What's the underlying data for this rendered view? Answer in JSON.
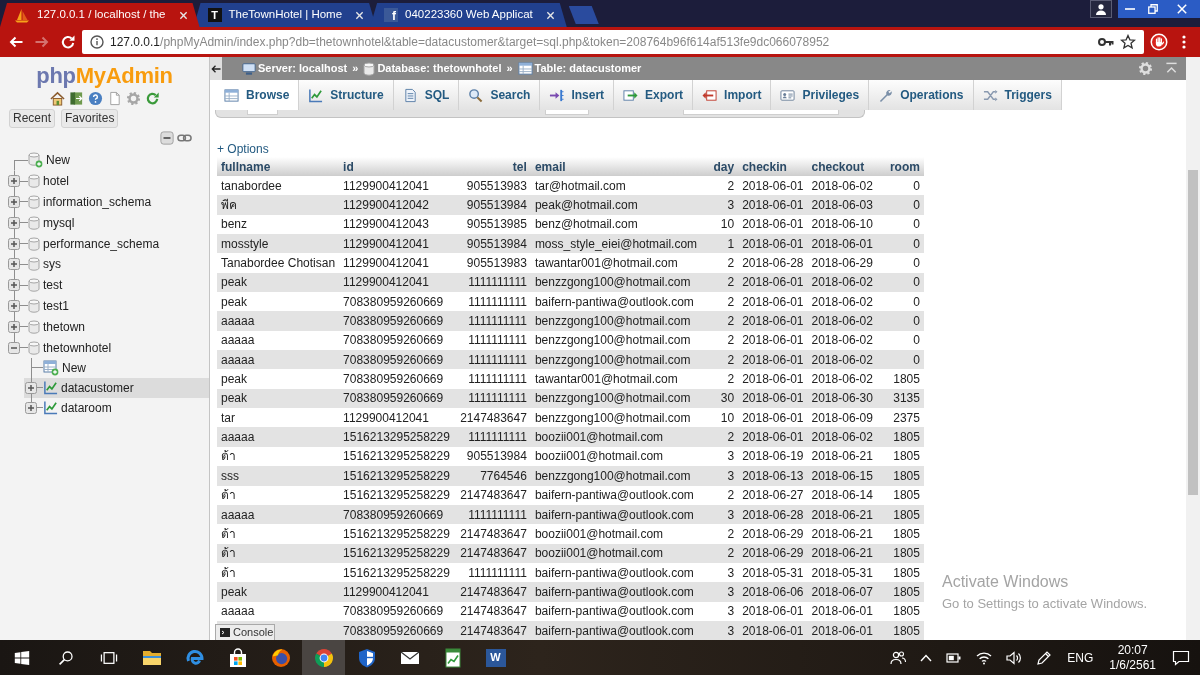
{
  "browser": {
    "tabs": [
      {
        "title": "127.0.0.1 / localhost / the",
        "favicon": {
          "kind": "sail"
        },
        "selected": true
      },
      {
        "title": "TheTownHotel | Home",
        "favicon": {
          "kind": "letter",
          "text": "T"
        },
        "selected": false
      },
      {
        "title": "040223360 Web Applicat",
        "favicon": {
          "kind": "social",
          "text": "f"
        },
        "selected": false
      }
    ],
    "nav_buttons": [
      {
        "kind": "back",
        "disabled": false
      },
      {
        "kind": "forward",
        "disabled": true
      },
      {
        "kind": "reload",
        "disabled": false
      }
    ],
    "address": {
      "host": "127.0.0.1",
      "path": "/phpMyAdmin/index.php?db=thetownhotel&table=datacustomer&target=sql.php&token=208764b96f614af513fe9dc066078952"
    }
  },
  "navigation": {
    "logo": [
      {
        "text": "php",
        "color": "#6c78af"
      },
      {
        "text": "MyAdmin",
        "color": "#f89c0e"
      }
    ],
    "tabs": [
      {
        "label": "Recent"
      },
      {
        "label": "Favorites"
      }
    ],
    "tree": [
      {
        "kind": "new",
        "label": "New",
        "selected": false
      },
      {
        "kind": "database",
        "label": "hotel",
        "expanded": false,
        "selected": false
      },
      {
        "kind": "database",
        "label": "information_schema",
        "expanded": false,
        "selected": false
      },
      {
        "kind": "database",
        "label": "mysql",
        "expanded": false,
        "selected": false
      },
      {
        "kind": "database",
        "label": "performance_schema",
        "expanded": false,
        "selected": false
      },
      {
        "kind": "database",
        "label": "sys",
        "expanded": false,
        "selected": false
      },
      {
        "kind": "database",
        "label": "test",
        "expanded": false,
        "selected": false
      },
      {
        "kind": "database",
        "label": "test1",
        "expanded": false,
        "selected": false
      },
      {
        "kind": "database",
        "label": "thetown",
        "expanded": false,
        "selected": false
      },
      {
        "kind": "database",
        "label": "thetownhotel",
        "expanded": true,
        "selected": false,
        "children": [
          {
            "kind": "new",
            "label": "New",
            "selected": false
          },
          {
            "kind": "table",
            "label": "datacustomer",
            "expanded": false,
            "selected": true
          },
          {
            "kind": "table",
            "label": "dataroom",
            "expanded": false,
            "selected": false
          }
        ]
      }
    ]
  },
  "main": {
    "breadcrumb": [
      {
        "kind": "server",
        "label": "Server: localhost"
      },
      {
        "kind": "separator",
        "label": "»"
      },
      {
        "kind": "database",
        "label": "Database: thetownhotel"
      },
      {
        "kind": "separator",
        "label": "»"
      },
      {
        "kind": "table",
        "label": "Table: datacustomer"
      }
    ],
    "menu": [
      {
        "kind": "browse",
        "label": "Browse",
        "selected": true
      },
      {
        "kind": "structure",
        "label": "Structure",
        "selected": false
      },
      {
        "kind": "sql",
        "label": "SQL",
        "selected": false
      },
      {
        "kind": "search",
        "label": "Search",
        "selected": false
      },
      {
        "kind": "insert",
        "label": "Insert",
        "selected": false
      },
      {
        "kind": "export",
        "label": "Export",
        "selected": false
      },
      {
        "kind": "import",
        "label": "Import",
        "selected": false
      },
      {
        "kind": "privileges",
        "label": "Privileges",
        "selected": false
      },
      {
        "kind": "operations",
        "label": "Operations",
        "selected": false
      },
      {
        "kind": "triggers",
        "label": "Triggers",
        "selected": false
      }
    ],
    "options_link": "+ Options",
    "table": {
      "columns": [
        {
          "label": "fullname",
          "kind": "text"
        },
        {
          "label": "id",
          "kind": "text"
        },
        {
          "label": "tel",
          "kind": "number"
        },
        {
          "label": "email",
          "kind": "text"
        },
        {
          "label": "day",
          "kind": "number"
        },
        {
          "label": "checkin",
          "kind": "text"
        },
        {
          "label": "checkout",
          "kind": "text"
        },
        {
          "label": "room",
          "kind": "number"
        }
      ],
      "rows": [
        {
          "cells": [
            "tanabordee",
            "1129900412041",
            "905513983",
            "tar@hotmail.com",
            "2",
            "2018-06-01",
            "2018-06-02",
            "0"
          ]
        },
        {
          "cells": [
            "พีค",
            "1129900412042",
            "905513984",
            "peak@hotmail.com",
            "3",
            "2018-06-01",
            "2018-06-03",
            "0"
          ]
        },
        {
          "cells": [
            "benz",
            "1129900412043",
            "905513985",
            "benz@hotmail.com",
            "10",
            "2018-06-01",
            "2018-06-10",
            "0"
          ]
        },
        {
          "cells": [
            "mosstyle",
            "1129900412041",
            "905513984",
            "moss_style_eiei@hotmail.com",
            "1",
            "2018-06-01",
            "2018-06-01",
            "0"
          ]
        },
        {
          "cells": [
            "Tanabordee Chotisan",
            "1129900412041",
            "905513983",
            "tawantar001@hotmail.com",
            "2",
            "2018-06-28",
            "2018-06-29",
            "0"
          ]
        },
        {
          "cells": [
            "peak",
            "1129900412041",
            "1111111111",
            "benzzgong100@hotmail.com",
            "2",
            "2018-06-01",
            "2018-06-02",
            "0"
          ]
        },
        {
          "cells": [
            "peak",
            "708380959260669",
            "1111111111",
            "baifern-pantiwa@outlook.com",
            "2",
            "2018-06-01",
            "2018-06-02",
            "0"
          ]
        },
        {
          "cells": [
            "aaaaa",
            "708380959260669",
            "1111111111",
            "benzzgong100@hotmail.com",
            "2",
            "2018-06-01",
            "2018-06-02",
            "0"
          ]
        },
        {
          "cells": [
            "aaaaa",
            "708380959260669",
            "1111111111",
            "benzzgong100@hotmail.com",
            "2",
            "2018-06-01",
            "2018-06-02",
            "0"
          ]
        },
        {
          "cells": [
            "aaaaa",
            "708380959260669",
            "1111111111",
            "benzzgong100@hotmail.com",
            "2",
            "2018-06-01",
            "2018-06-02",
            "0"
          ]
        },
        {
          "cells": [
            "peak",
            "708380959260669",
            "1111111111",
            "tawantar001@hotmail.com",
            "2",
            "2018-06-01",
            "2018-06-02",
            "1805"
          ]
        },
        {
          "cells": [
            "peak",
            "708380959260669",
            "1111111111",
            "benzzgong100@hotmail.com",
            "30",
            "2018-06-01",
            "2018-06-30",
            "3135"
          ]
        },
        {
          "cells": [
            "tar",
            "1129900412041",
            "2147483647",
            "benzzgong100@hotmail.com",
            "10",
            "2018-06-01",
            "2018-06-09",
            "2375"
          ]
        },
        {
          "cells": [
            "aaaaa",
            "1516213295258229",
            "1111111111",
            "boozii001@hotmail.com",
            "2",
            "2018-06-01",
            "2018-06-02",
            "1805"
          ]
        },
        {
          "cells": [
            "ต้า",
            "1516213295258229",
            "905513984",
            "boozii001@hotmail.com",
            "3",
            "2018-06-19",
            "2018-06-21",
            "1805"
          ]
        },
        {
          "cells": [
            "sss",
            "1516213295258229",
            "7764546",
            "benzzgong100@hotmail.com",
            "3",
            "2018-06-13",
            "2018-06-15",
            "1805"
          ]
        },
        {
          "cells": [
            "ต้า",
            "1516213295258229",
            "2147483647",
            "baifern-pantiwa@outlook.com",
            "2",
            "2018-06-27",
            "2018-06-14",
            "1805"
          ]
        },
        {
          "cells": [
            "aaaaa",
            "708380959260669",
            "1111111111",
            "baifern-pantiwa@outlook.com",
            "3",
            "2018-06-28",
            "2018-06-21",
            "1805"
          ]
        },
        {
          "cells": [
            "ต้า",
            "1516213295258229",
            "2147483647",
            "boozii001@hotmail.com",
            "2",
            "2018-06-29",
            "2018-06-21",
            "1805"
          ]
        },
        {
          "cells": [
            "ต้า",
            "1516213295258229",
            "2147483647",
            "boozii001@hotmail.com",
            "2",
            "2018-06-29",
            "2018-06-21",
            "1805"
          ]
        },
        {
          "cells": [
            "ต้า",
            "1516213295258229",
            "1111111111",
            "baifern-pantiwa@outlook.com",
            "3",
            "2018-05-31",
            "2018-05-31",
            "1805"
          ]
        },
        {
          "cells": [
            "peak",
            "1129900412041",
            "2147483647",
            "baifern-pantiwa@outlook.com",
            "3",
            "2018-06-06",
            "2018-06-07",
            "1805"
          ]
        },
        {
          "cells": [
            "aaaaa",
            "708380959260669",
            "2147483647",
            "baifern-pantiwa@outlook.com",
            "3",
            "2018-06-01",
            "2018-06-01",
            "1805"
          ]
        },
        {
          "cells": [
            null,
            "708380959260669",
            "2147483647",
            "baifern-pantiwa@outlook.com",
            "3",
            "2018-06-01",
            "2018-06-01",
            "1805"
          ]
        }
      ]
    },
    "console": "Console"
  },
  "activation_notice": {
    "title": "Activate Windows",
    "message": "Go to Settings to activate Windows."
  },
  "taskbar": {
    "apps": [
      {
        "kind": "folder",
        "selected": false
      },
      {
        "kind": "swirl",
        "selected": false
      },
      {
        "kind": "bag",
        "selected": false
      },
      {
        "kind": "globe",
        "selected": false
      },
      {
        "kind": "wheel",
        "selected": true
      },
      {
        "kind": "shield",
        "selected": false
      },
      {
        "kind": "envelope",
        "selected": false
      },
      {
        "kind": "chart",
        "selected": false
      },
      {
        "kind": "letter",
        "icon_text": "W",
        "selected": false
      }
    ],
    "language": "ENG",
    "time": "20:07",
    "date": "1/6/2561"
  }
}
